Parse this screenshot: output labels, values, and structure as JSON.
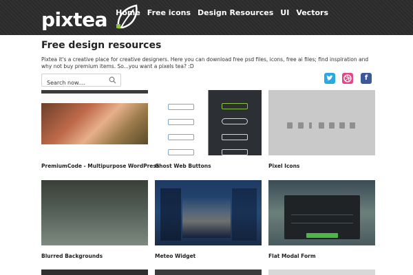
{
  "header": {
    "logo_text": "pixtea",
    "nav": [
      "Home",
      "Free icons",
      "Design Resources",
      "UI",
      "Vectors"
    ]
  },
  "main": {
    "title": "Free design resources",
    "intro": "Pixtea it's a creative place for creative designers. Here you can download free psd files, icons, free ai files; find inspiration and why not buy premium items. So...you want a pixels tea? :D",
    "search": {
      "placeholder": "Search now...."
    },
    "social": [
      "twitter-icon",
      "dribbble-icon",
      "facebook-icon"
    ]
  },
  "cards": [
    {
      "title": "PremiumCode - Multipurpose WordPress"
    },
    {
      "title": "Ghost Web Buttons"
    },
    {
      "title": "Pixel Icons"
    },
    {
      "title": "Blurred Backgrounds"
    },
    {
      "title": "Meteo Widget"
    },
    {
      "title": "Flat Modal Form"
    }
  ],
  "colors": {
    "header_bg": "#2a2a2a",
    "accent_green": "#4cb748",
    "twitter": "#2aa9e0",
    "dribbble": "#e5468a",
    "facebook": "#3b5998"
  }
}
